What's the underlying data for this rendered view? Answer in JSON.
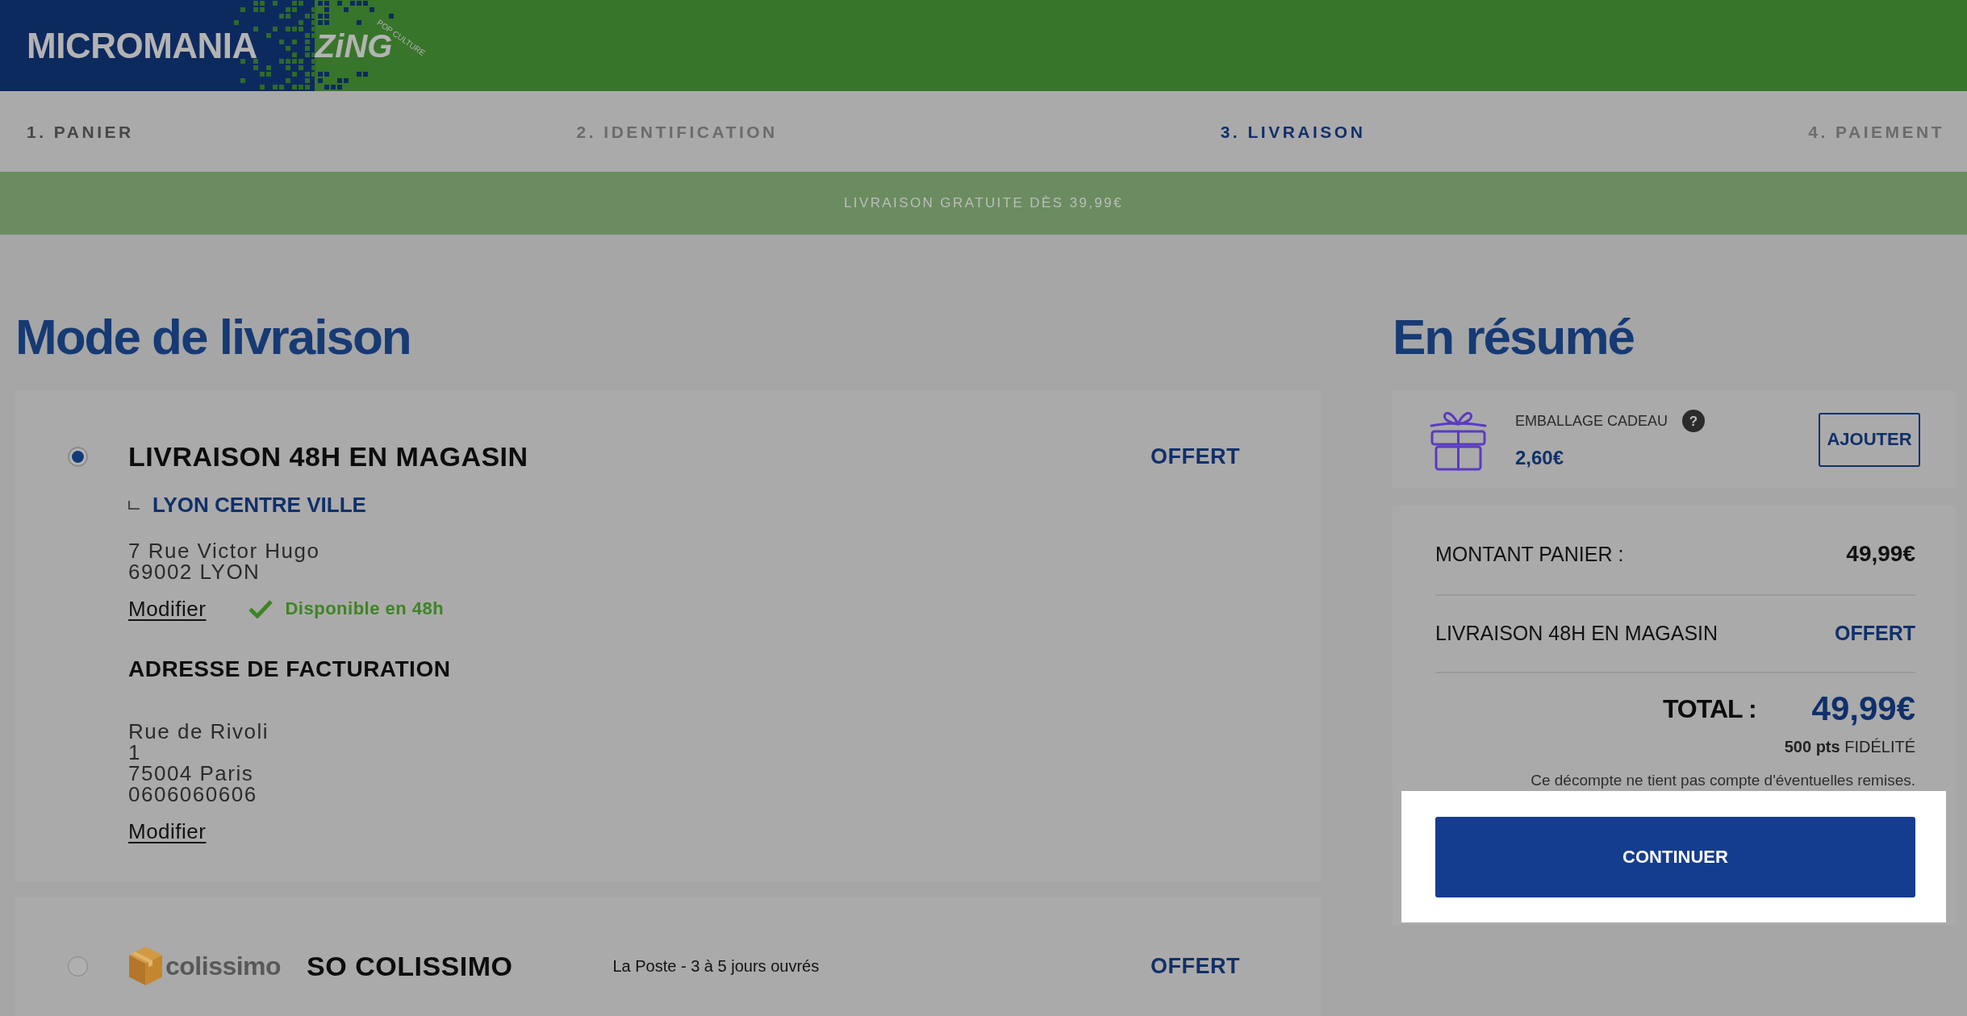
{
  "header": {
    "logo": {
      "brand": "MICROMANIA",
      "sub_brand": "ZiNG",
      "tagline": "POP CULTURE"
    }
  },
  "steps": [
    {
      "label": "1. PANIER",
      "selected": false,
      "muted": false
    },
    {
      "label": "2. IDENTIFICATION",
      "selected": false,
      "muted": true
    },
    {
      "label": "3. LIVRAISON",
      "selected": true,
      "muted": false
    },
    {
      "label": "4. PAIEMENT",
      "selected": false,
      "muted": true
    }
  ],
  "banner": {
    "text": "LIVRAISON GRATUITE DÈS 39,99€"
  },
  "delivery": {
    "title": "Mode de livraison",
    "options": [
      {
        "kind": "store",
        "selected": true,
        "name": "LIVRAISON 48H EN MAGASIN",
        "price": "OFFERT",
        "store": "LYON CENTRE VILLE",
        "address": [
          "7 Rue Victor Hugo",
          "69002 LYON"
        ],
        "edit_link": "Modifier",
        "availability": "Disponible en 48h",
        "billing": {
          "title": "ADRESSE DE FACTURATION",
          "address": [
            "Rue de Rivoli",
            "1",
            "75004 Paris",
            "0606060606"
          ],
          "edit_link": "Modifier"
        }
      },
      {
        "kind": "carrier",
        "selected": false,
        "carrier_logo": "colissimo",
        "name": "SO COLISSIMO",
        "description": "La Poste - 3 à 5 jours ouvrés",
        "price": "OFFERT"
      }
    ]
  },
  "summary": {
    "title": "En résumé",
    "gift_wrap": {
      "label": "EMBALLAGE CADEAU",
      "help": "?",
      "price": "2,60€",
      "button": "AJOUTER"
    },
    "lines": [
      {
        "kind": "amount",
        "label": "MONTANT PANIER :",
        "value": "49,99€"
      },
      {
        "kind": "free",
        "label": "LIVRAISON 48H EN MAGASIN",
        "value": "OFFERT"
      }
    ],
    "total": {
      "label": "TOTAL :",
      "value": "49,99€"
    },
    "loyalty": "**500 pts** FIDÉLITÉ",
    "note": "Ce décompte ne tient pas compte d'éventuelles remises.",
    "continue_button": "CONTINUER"
  }
}
